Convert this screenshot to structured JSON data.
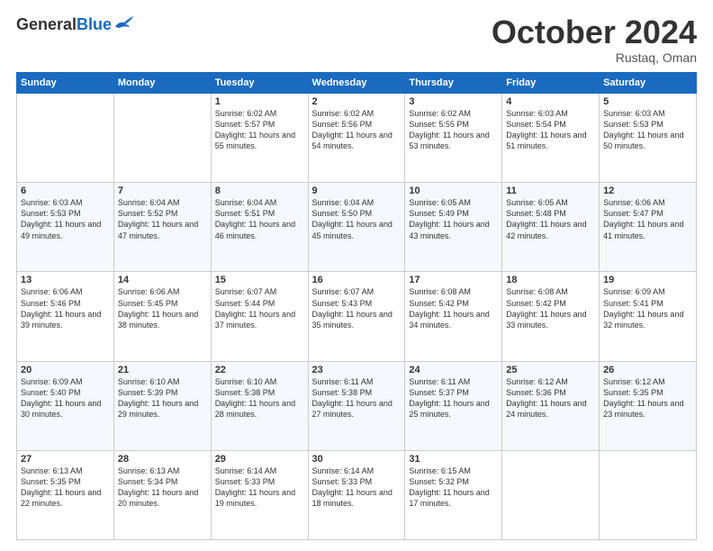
{
  "logo": {
    "general": "General",
    "blue": "Blue"
  },
  "header": {
    "month": "October 2024",
    "location": "Rustaq, Oman"
  },
  "weekdays": [
    "Sunday",
    "Monday",
    "Tuesday",
    "Wednesday",
    "Thursday",
    "Friday",
    "Saturday"
  ],
  "weeks": [
    [
      {
        "day": "",
        "info": ""
      },
      {
        "day": "",
        "info": ""
      },
      {
        "day": "1",
        "info": "Sunrise: 6:02 AM\nSunset: 5:57 PM\nDaylight: 11 hours and 55 minutes."
      },
      {
        "day": "2",
        "info": "Sunrise: 6:02 AM\nSunset: 5:56 PM\nDaylight: 11 hours and 54 minutes."
      },
      {
        "day": "3",
        "info": "Sunrise: 6:02 AM\nSunset: 5:55 PM\nDaylight: 11 hours and 53 minutes."
      },
      {
        "day": "4",
        "info": "Sunrise: 6:03 AM\nSunset: 5:54 PM\nDaylight: 11 hours and 51 minutes."
      },
      {
        "day": "5",
        "info": "Sunrise: 6:03 AM\nSunset: 5:53 PM\nDaylight: 11 hours and 50 minutes."
      }
    ],
    [
      {
        "day": "6",
        "info": "Sunrise: 6:03 AM\nSunset: 5:53 PM\nDaylight: 11 hours and 49 minutes."
      },
      {
        "day": "7",
        "info": "Sunrise: 6:04 AM\nSunset: 5:52 PM\nDaylight: 11 hours and 47 minutes."
      },
      {
        "day": "8",
        "info": "Sunrise: 6:04 AM\nSunset: 5:51 PM\nDaylight: 11 hours and 46 minutes."
      },
      {
        "day": "9",
        "info": "Sunrise: 6:04 AM\nSunset: 5:50 PM\nDaylight: 11 hours and 45 minutes."
      },
      {
        "day": "10",
        "info": "Sunrise: 6:05 AM\nSunset: 5:49 PM\nDaylight: 11 hours and 43 minutes."
      },
      {
        "day": "11",
        "info": "Sunrise: 6:05 AM\nSunset: 5:48 PM\nDaylight: 11 hours and 42 minutes."
      },
      {
        "day": "12",
        "info": "Sunrise: 6:06 AM\nSunset: 5:47 PM\nDaylight: 11 hours and 41 minutes."
      }
    ],
    [
      {
        "day": "13",
        "info": "Sunrise: 6:06 AM\nSunset: 5:46 PM\nDaylight: 11 hours and 39 minutes."
      },
      {
        "day": "14",
        "info": "Sunrise: 6:06 AM\nSunset: 5:45 PM\nDaylight: 11 hours and 38 minutes."
      },
      {
        "day": "15",
        "info": "Sunrise: 6:07 AM\nSunset: 5:44 PM\nDaylight: 11 hours and 37 minutes."
      },
      {
        "day": "16",
        "info": "Sunrise: 6:07 AM\nSunset: 5:43 PM\nDaylight: 11 hours and 35 minutes."
      },
      {
        "day": "17",
        "info": "Sunrise: 6:08 AM\nSunset: 5:42 PM\nDaylight: 11 hours and 34 minutes."
      },
      {
        "day": "18",
        "info": "Sunrise: 6:08 AM\nSunset: 5:42 PM\nDaylight: 11 hours and 33 minutes."
      },
      {
        "day": "19",
        "info": "Sunrise: 6:09 AM\nSunset: 5:41 PM\nDaylight: 11 hours and 32 minutes."
      }
    ],
    [
      {
        "day": "20",
        "info": "Sunrise: 6:09 AM\nSunset: 5:40 PM\nDaylight: 11 hours and 30 minutes."
      },
      {
        "day": "21",
        "info": "Sunrise: 6:10 AM\nSunset: 5:39 PM\nDaylight: 11 hours and 29 minutes."
      },
      {
        "day": "22",
        "info": "Sunrise: 6:10 AM\nSunset: 5:38 PM\nDaylight: 11 hours and 28 minutes."
      },
      {
        "day": "23",
        "info": "Sunrise: 6:11 AM\nSunset: 5:38 PM\nDaylight: 11 hours and 27 minutes."
      },
      {
        "day": "24",
        "info": "Sunrise: 6:11 AM\nSunset: 5:37 PM\nDaylight: 11 hours and 25 minutes."
      },
      {
        "day": "25",
        "info": "Sunrise: 6:12 AM\nSunset: 5:36 PM\nDaylight: 11 hours and 24 minutes."
      },
      {
        "day": "26",
        "info": "Sunrise: 6:12 AM\nSunset: 5:35 PM\nDaylight: 11 hours and 23 minutes."
      }
    ],
    [
      {
        "day": "27",
        "info": "Sunrise: 6:13 AM\nSunset: 5:35 PM\nDaylight: 11 hours and 22 minutes."
      },
      {
        "day": "28",
        "info": "Sunrise: 6:13 AM\nSunset: 5:34 PM\nDaylight: 11 hours and 20 minutes."
      },
      {
        "day": "29",
        "info": "Sunrise: 6:14 AM\nSunset: 5:33 PM\nDaylight: 11 hours and 19 minutes."
      },
      {
        "day": "30",
        "info": "Sunrise: 6:14 AM\nSunset: 5:33 PM\nDaylight: 11 hours and 18 minutes."
      },
      {
        "day": "31",
        "info": "Sunrise: 6:15 AM\nSunset: 5:32 PM\nDaylight: 11 hours and 17 minutes."
      },
      {
        "day": "",
        "info": ""
      },
      {
        "day": "",
        "info": ""
      }
    ]
  ]
}
